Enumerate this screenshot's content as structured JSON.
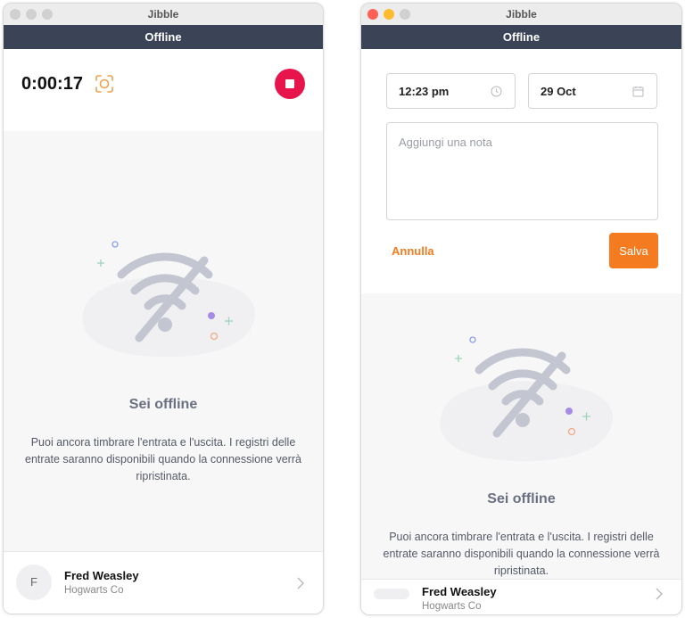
{
  "app_name": "Jibble",
  "status_bar": "Offline",
  "left": {
    "timer": "0:00:17",
    "offline": {
      "title": "Sei offline",
      "description": "Puoi ancora timbrare l'entrata e l'uscita. I registri delle entrate saranno disponibili quando la connessione verrà ripristinata."
    },
    "user": {
      "initial": "F",
      "name": "Fred Weasley",
      "company": "Hogwarts Co"
    }
  },
  "right": {
    "time_value": "12:23 pm",
    "date_value": "29 Oct",
    "note_placeholder": "Aggiungi una nota",
    "cancel_label": "Annulla",
    "save_label": "Salva",
    "offline": {
      "title": "Sei offline",
      "description": "Puoi ancora timbrare l'entrata e l'uscita. I registri delle entrate saranno disponibili quando la connessione verrà ripristinata."
    },
    "user": {
      "name": "Fred Weasley",
      "company": "Hogwarts Co"
    }
  },
  "colors": {
    "accent": "#f47b20",
    "stop_button": "#e8144c",
    "status_bar": "#3b4457"
  },
  "icons": [
    "scan-icon",
    "stop-icon",
    "clock-icon",
    "calendar-icon",
    "wifi-off-icon",
    "chevron-right-icon"
  ]
}
